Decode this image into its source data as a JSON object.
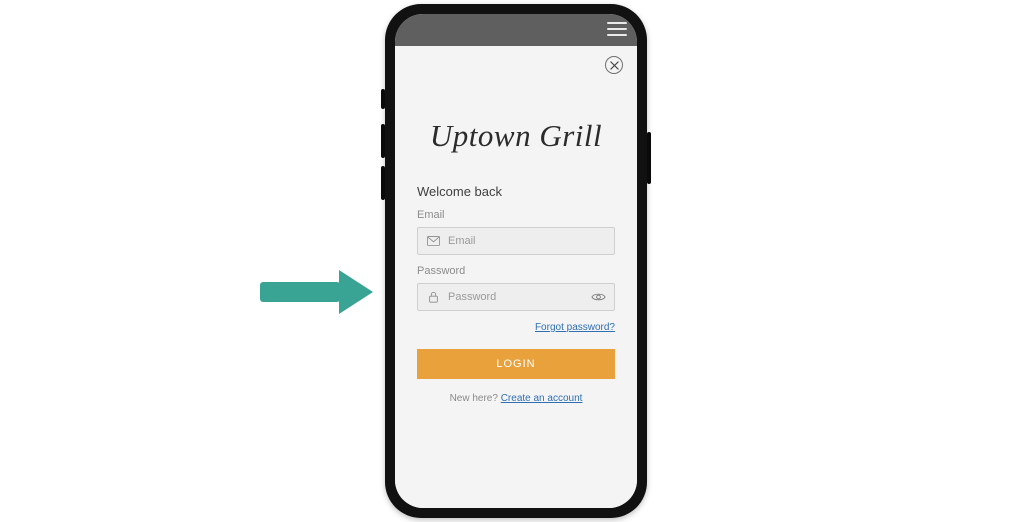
{
  "brand": {
    "name": "Uptown Grill"
  },
  "auth": {
    "welcome": "Welcome back",
    "email_label": "Email",
    "email_placeholder": "Email",
    "password_label": "Password",
    "password_placeholder": "Password",
    "forgot_link": "Forgot password?",
    "login_button": "LOGIN",
    "signup_prompt": "New here? ",
    "signup_link": "Create an account"
  },
  "colors": {
    "accent": "#e9a23b",
    "link": "#2f6fb3",
    "arrow": "#3aa494"
  }
}
